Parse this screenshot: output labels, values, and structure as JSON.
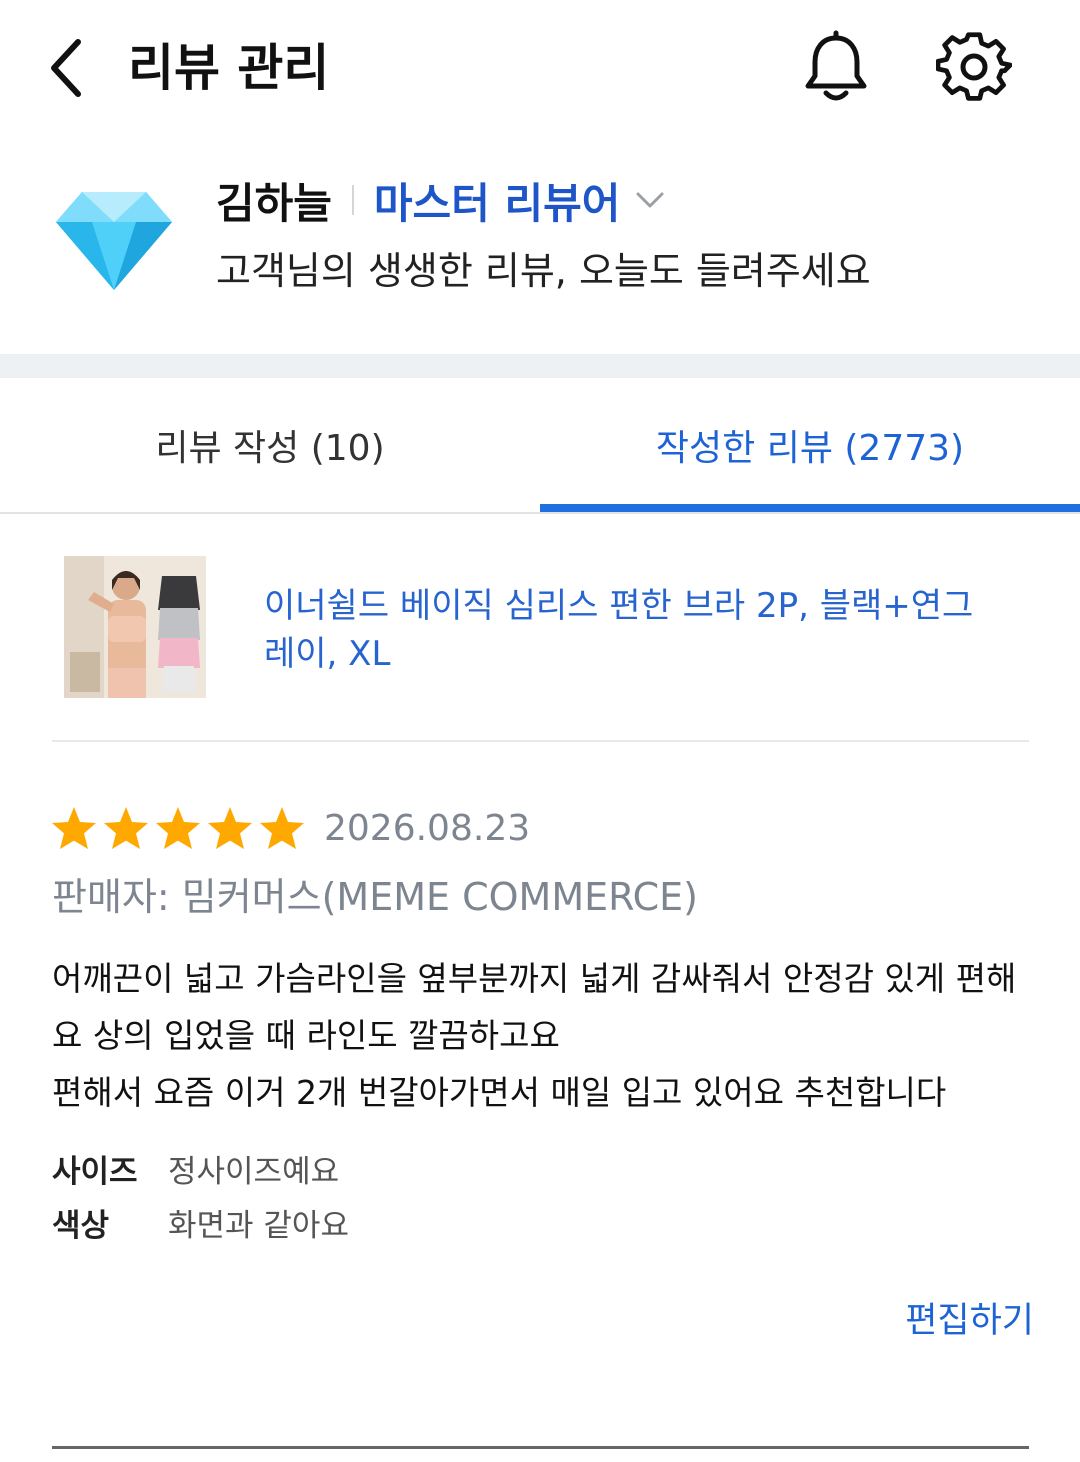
{
  "header": {
    "title": "리뷰 관리",
    "icons": {
      "back": "chevron-left-icon",
      "notifications": "bell-icon",
      "settings": "gear-icon"
    }
  },
  "profile": {
    "badge_icon": "diamond-icon",
    "name": "김하늘",
    "grade": "마스터 리뷰어",
    "message": "고객님의 생생한 리뷰, 오늘도 들려주세요"
  },
  "tabs": [
    {
      "label": "리뷰 작성 (10)",
      "active": false
    },
    {
      "label": "작성한 리뷰 (2773)",
      "active": true
    }
  ],
  "review": {
    "product_name": "이너쉴드 베이직 심리스 편한 브라 2P, 블랙+연그레이, XL",
    "rating": 5,
    "max_rating": 5,
    "date": "2026.08.23",
    "seller": "판매자: 밈커머스(MEME COMMERCE)",
    "body": "어깨끈이 넓고 가슴라인을 옆부분까지 넓게 감싸줘서 안정감 있게 편해요 상의 입었을 때 라인도 깔끔하고요\n편해서 요즘 이거 2개 번갈아가면서 매일 입고 있어요 추천합니다",
    "attributes": [
      {
        "label": "사이즈",
        "value": "정사이즈예요"
      },
      {
        "label": "색상",
        "value": "화면과 같아요"
      }
    ],
    "edit_label": "편집하기"
  },
  "colors": {
    "accent_blue": "#1e63d6",
    "grade_blue": "#1e55c8",
    "star_orange": "#ffa800",
    "gem_cyan": "#3ec8f5",
    "muted_gray": "#7d8590",
    "band_gray": "#eef1f4"
  }
}
